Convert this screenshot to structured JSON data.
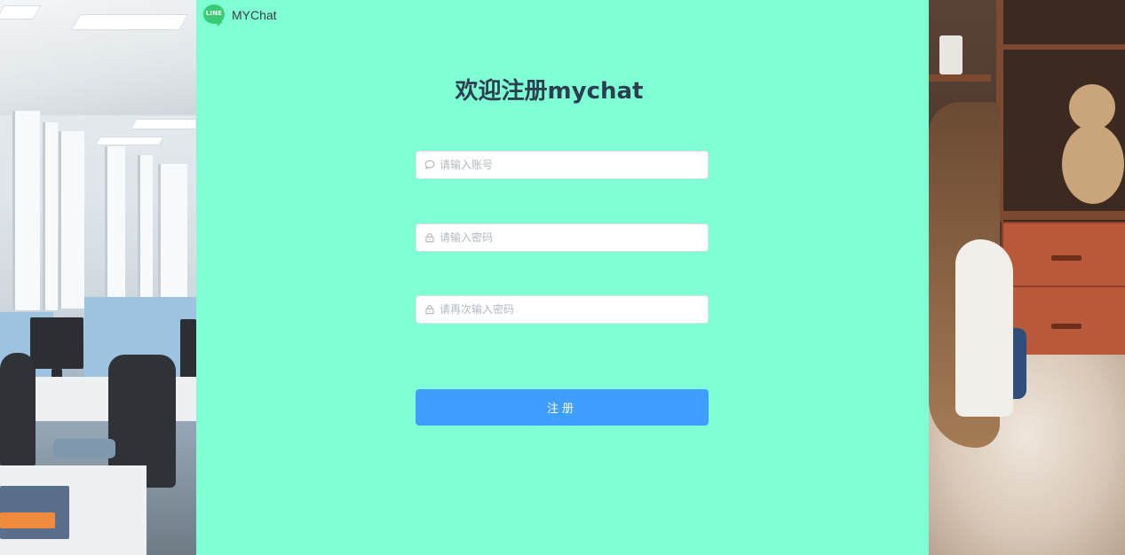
{
  "brand": {
    "logo_text": "LINE",
    "name": "MYChat",
    "accent": "#3acb74"
  },
  "page": {
    "title": "欢迎注册mychat",
    "background": "#7fffd4"
  },
  "form": {
    "account": {
      "placeholder": "请输入账号",
      "value": "",
      "icon": "chat-bubble-icon"
    },
    "password": {
      "placeholder": "请输入密码",
      "value": "",
      "icon": "lock-icon"
    },
    "confirm_password": {
      "placeholder": "请再次输入密码",
      "value": "",
      "icon": "lock-icon"
    },
    "submit_label": "注册",
    "submit_color": "#409eff"
  }
}
